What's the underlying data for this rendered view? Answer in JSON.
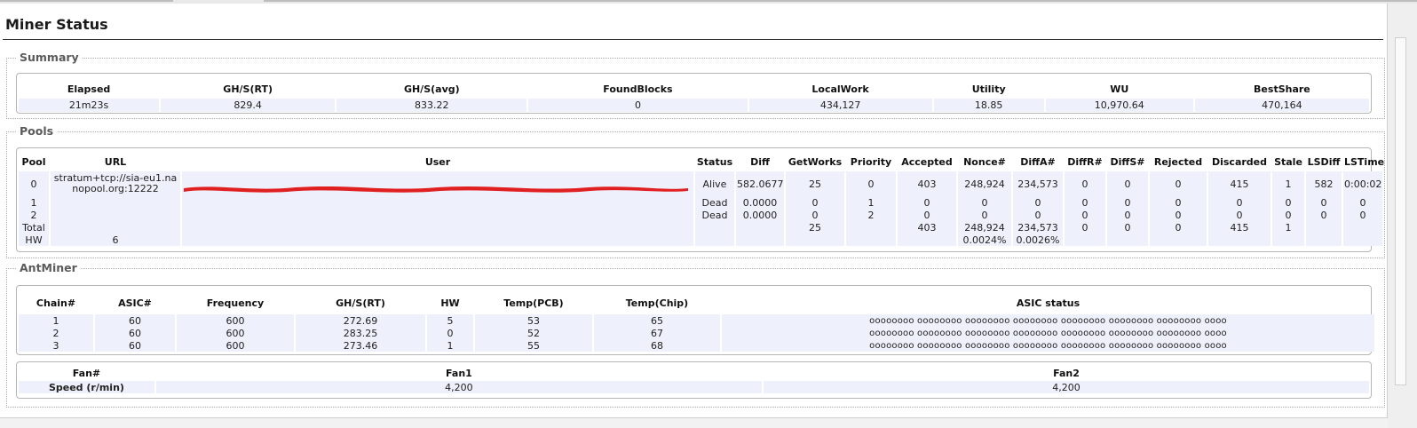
{
  "title": "Miner Status",
  "summary": {
    "legend": "Summary",
    "headers": [
      "Elapsed",
      "GH/S(RT)",
      "GH/S(avg)",
      "FoundBlocks",
      "LocalWork",
      "Utility",
      "WU",
      "BestShare"
    ],
    "values": [
      "21m23s",
      "829.4",
      "833.22",
      "0",
      "434,127",
      "18.85",
      "10,970.64",
      "470,164"
    ]
  },
  "pools": {
    "legend": "Pools",
    "headers": [
      "Pool",
      "URL",
      "User",
      "Status",
      "Diff",
      "GetWorks",
      "Priority",
      "Accepted",
      "Nonce#",
      "DiffA#",
      "DiffR#",
      "DiffS#",
      "Rejected",
      "Discarded",
      "Stale",
      "LSDiff",
      "LSTime"
    ],
    "rows": [
      [
        "0",
        "stratum+tcp://sia-eu1.nanopool.org:12222",
        "",
        "Alive",
        "582.0677",
        "25",
        "0",
        "403",
        "248,924",
        "234,573",
        "0",
        "0",
        "0",
        "415",
        "1",
        "582",
        "0:00:02"
      ],
      [
        "1",
        "",
        "",
        "Dead",
        "0.0000",
        "0",
        "1",
        "0",
        "0",
        "0",
        "0",
        "0",
        "0",
        "0",
        "0",
        "0",
        "0"
      ],
      [
        "2",
        "",
        "",
        "Dead",
        "0.0000",
        "0",
        "2",
        "0",
        "0",
        "0",
        "0",
        "0",
        "0",
        "0",
        "0",
        "0",
        "0"
      ],
      [
        "Total",
        "",
        "",
        "",
        "",
        "25",
        "",
        "403",
        "248,924",
        "234,573",
        "0",
        "0",
        "0",
        "415",
        "1",
        "",
        ""
      ],
      [
        "HW",
        "6",
        "",
        "",
        "",
        "",
        "",
        "",
        "0.0024%",
        "0.0026%",
        "",
        "",
        "",
        "",
        "",
        "",
        ""
      ]
    ],
    "user_redaction_color": "#e02020"
  },
  "antminer": {
    "legend": "AntMiner",
    "chain_headers": [
      "Chain#",
      "ASIC#",
      "Frequency",
      "GH/S(RT)",
      "HW",
      "Temp(PCB)",
      "Temp(Chip)",
      "ASIC status"
    ],
    "chain_rows": [
      [
        "1",
        "60",
        "600",
        "272.69",
        "5",
        "53",
        "65",
        "oooooooo oooooooo oooooooo oooooooo oooooooo oooooooo oooooooo oooo"
      ],
      [
        "2",
        "60",
        "600",
        "283.25",
        "0",
        "52",
        "67",
        "oooooooo oooooooo oooooooo oooooooo oooooooo oooooooo oooooooo oooo"
      ],
      [
        "3",
        "60",
        "600",
        "273.46",
        "1",
        "55",
        "68",
        "oooooooo oooooooo oooooooo oooooooo oooooooo oooooooo oooooooo oooo"
      ]
    ],
    "fan_headers": [
      "Fan#",
      "Fan1",
      "Fan2"
    ],
    "fan_row": [
      "Speed (r/min)",
      "4,200",
      "4,200"
    ]
  },
  "colors": {
    "row_band": "#eef0fb",
    "legend_text": "#5a5a5a",
    "box_border": "#b5b5b5"
  }
}
